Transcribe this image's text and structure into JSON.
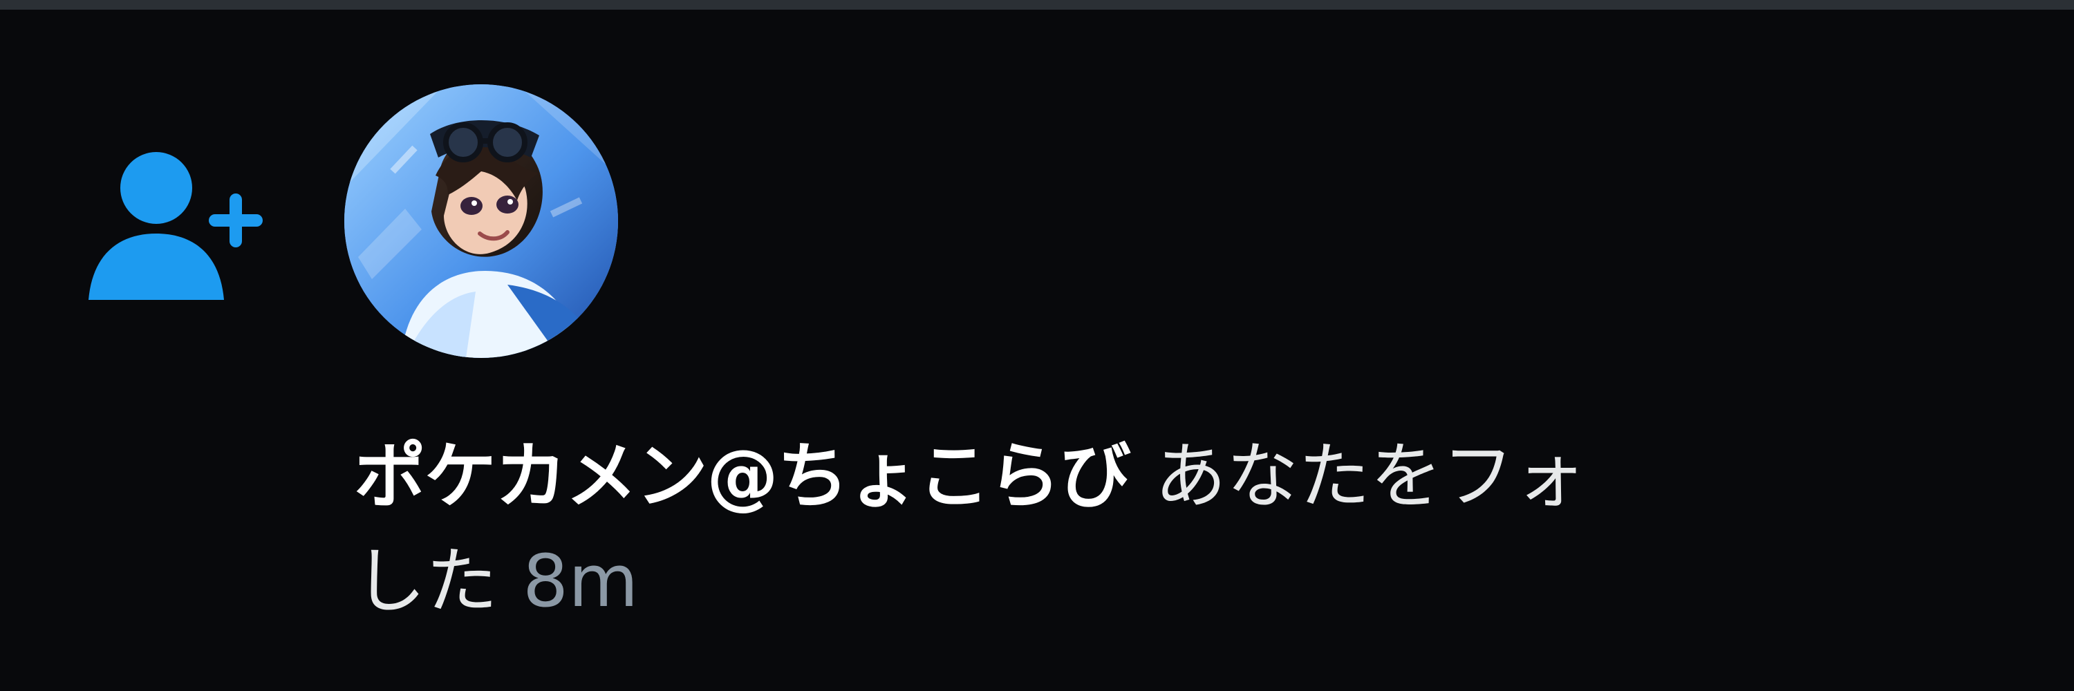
{
  "notification": {
    "type_icon": "person-plus-icon",
    "user_name": "ポケカメン@ちょこらび",
    "action_text_part1": "あなたをフォ",
    "action_text_part2": "した",
    "timestamp": "8m"
  },
  "colors": {
    "background": "#08090c",
    "accent": "#1d9bf0",
    "primary_text": "#ffffff",
    "secondary_text": "#8b98a5",
    "divider": "#2b3035"
  }
}
